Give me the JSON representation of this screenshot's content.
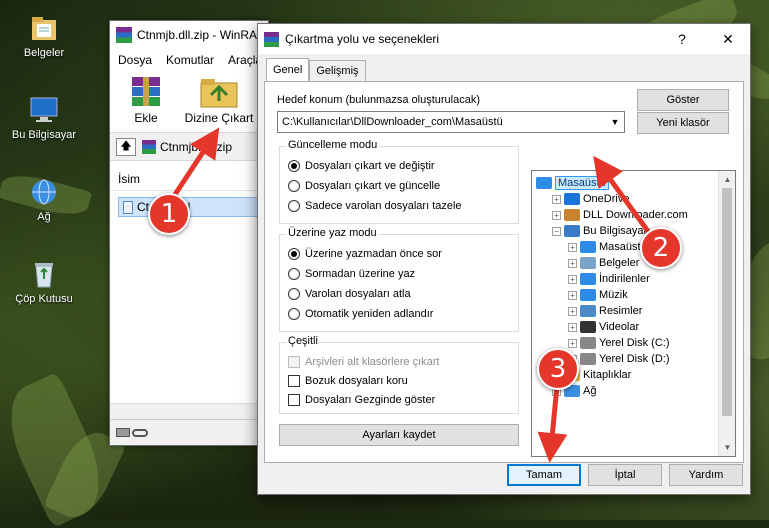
{
  "desktop": {
    "icons": [
      {
        "name": "documents-icon",
        "label": "Belgeler"
      },
      {
        "name": "this-pc-icon",
        "label": "Bu Bilgisayar"
      },
      {
        "name": "network-icon",
        "label": "Ağ"
      },
      {
        "name": "recycle-bin-icon",
        "label": "Çöp Kutusu"
      }
    ]
  },
  "winrar": {
    "title": "Ctnmjb.dll.zip - WinRAR",
    "menu": [
      "Dosya",
      "Komutlar",
      "Araçlar"
    ],
    "toolbar": {
      "extract_label": "Ekle",
      "extract_to_label": "Dizine Çıkart"
    },
    "path": "Ctnmjb.dll.zip",
    "column_name": "İsim",
    "file": "Ctnmjb.dll"
  },
  "dialog": {
    "title": "Çıkartma yolu ve seçenekleri",
    "help_glyph": "?",
    "close_glyph": "✕",
    "tabs": [
      "Genel",
      "Gelişmiş"
    ],
    "dest_label": "Hedef konum (bulunmazsa oluşturulacak)",
    "dest_value": "C:\\Kullanıcılar\\DllDownloader_com\\Masaüstü",
    "show_button": "Göster",
    "new_folder_button": "Yeni klasör",
    "update_mode": {
      "title": "Güncelleme modu",
      "options": [
        "Dosyaları çıkart ve değiştir",
        "Dosyaları çıkart ve güncelle",
        "Sadece varolan dosyaları tazele"
      ],
      "selected": 0
    },
    "overwrite_mode": {
      "title": "Üzerine yaz modu",
      "options": [
        "Üzerine yazmadan önce sor",
        "Sormadan üzerine yaz",
        "Varolan dosyaları atla",
        "Otomatik yeniden adlandır"
      ],
      "selected": 0
    },
    "misc": {
      "title": "Çeşitli",
      "options": [
        {
          "label": "Arşivleri alt klasörlere çıkart",
          "checked": false,
          "disabled": true
        },
        {
          "label": "Bozuk dosyaları koru",
          "checked": false,
          "disabled": false
        },
        {
          "label": "Dosyaları Gezginde göster",
          "checked": false,
          "disabled": false
        }
      ]
    },
    "save_settings_button": "Ayarları kaydet",
    "tree": [
      {
        "label": "Masaüstü",
        "icon": "desktop-folder-icon",
        "level": 0,
        "expander": "",
        "selected": true
      },
      {
        "label": "OneDrive",
        "icon": "onedrive-icon",
        "level": 1,
        "expander": "+"
      },
      {
        "label": "DLL Downloader.com",
        "icon": "user-icon",
        "level": 1,
        "expander": "+"
      },
      {
        "label": "Bu Bilgisayar",
        "icon": "computer-icon",
        "level": 1,
        "expander": "−"
      },
      {
        "label": "Masaüstü",
        "icon": "desktop-folder-icon",
        "level": 2,
        "expander": "+"
      },
      {
        "label": "Belgeler",
        "icon": "documents-folder-icon",
        "level": 2,
        "expander": "+"
      },
      {
        "label": "İndirilenler",
        "icon": "downloads-icon",
        "level": 2,
        "expander": "+"
      },
      {
        "label": "Müzik",
        "icon": "music-icon",
        "level": 2,
        "expander": "+"
      },
      {
        "label": "Resimler",
        "icon": "pictures-icon",
        "level": 2,
        "expander": "+"
      },
      {
        "label": "Videolar",
        "icon": "videos-icon",
        "level": 2,
        "expander": "+"
      },
      {
        "label": "Yerel Disk (C:)",
        "icon": "drive-icon",
        "level": 2,
        "expander": "+"
      },
      {
        "label": "Yerel Disk (D:)",
        "icon": "drive-icon",
        "level": 2,
        "expander": "+"
      },
      {
        "label": "Kitaplıklar",
        "icon": "libraries-icon",
        "level": 1,
        "expander": "+"
      },
      {
        "label": "Ağ",
        "icon": "network-icon",
        "level": 1,
        "expander": "+"
      }
    ],
    "ok_button": "Tamam",
    "cancel_button": "İptal",
    "help_button": "Yardım"
  },
  "annotations": [
    "1",
    "2",
    "3"
  ],
  "colors": {
    "accent": "#0078d7",
    "badge": "#e4362a",
    "selection": "#cce8ff"
  }
}
